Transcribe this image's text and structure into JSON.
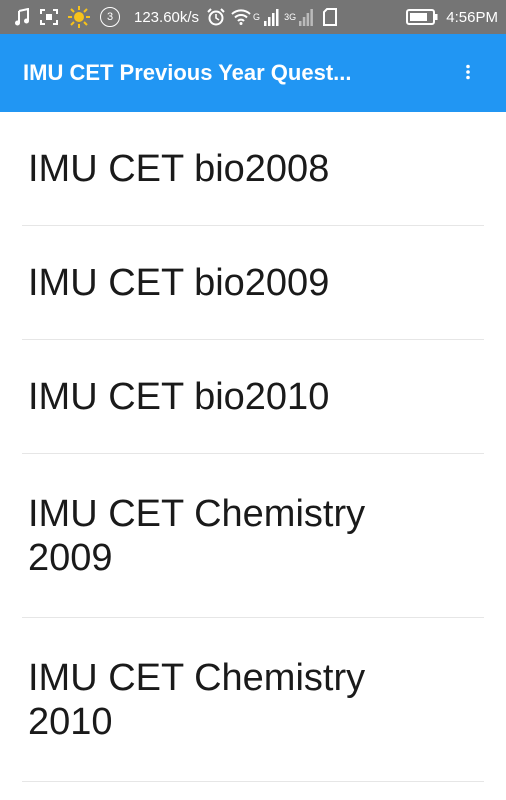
{
  "status_bar": {
    "network_speed": "123.60k/s",
    "notification_count": "3",
    "network_type": "3G",
    "wifi_label": "G",
    "time": "4:56PM",
    "icons": [
      "music-note-icon",
      "screenshot-icon",
      "brightness-icon",
      "notification-count-icon",
      "alarm-icon",
      "wifi-icon",
      "signal-icon",
      "sim-icon",
      "battery-icon"
    ]
  },
  "toolbar": {
    "title": "IMU CET Previous Year Quest...",
    "menu_icon": "overflow-menu-icon"
  },
  "list": {
    "items": [
      {
        "label": "IMU CET bio2008"
      },
      {
        "label": "IMU CET bio2009"
      },
      {
        "label": "IMU CET bio2010"
      },
      {
        "label": "IMU CET Chemistry 2009"
      },
      {
        "label": "IMU CET Chemistry 2010"
      }
    ]
  },
  "colors": {
    "toolbar": "#2196f3",
    "status_bar": "#757575"
  }
}
